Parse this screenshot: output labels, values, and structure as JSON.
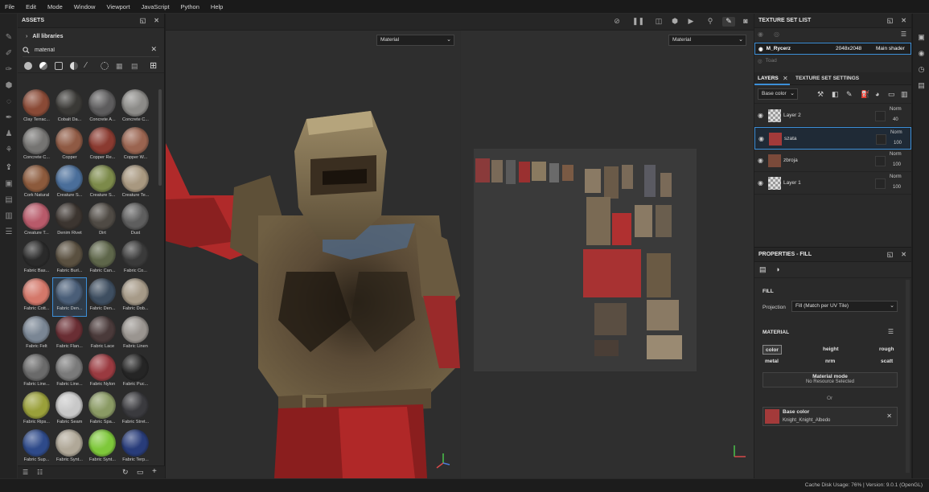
{
  "menu": [
    "File",
    "Edit",
    "Mode",
    "Window",
    "Viewport",
    "JavaScript",
    "Python",
    "Help"
  ],
  "assets": {
    "title": "ASSETS",
    "breadcrumb": "All libraries",
    "search_value": "material",
    "materials": [
      {
        "label": "Clay Terrac...",
        "color": "#8a4a36"
      },
      {
        "label": "Cobalt Da...",
        "color": "#3a3936"
      },
      {
        "label": "Concrete A...",
        "color": "#5d5c5d"
      },
      {
        "label": "Concrete C...",
        "color": "#8c8b88"
      },
      {
        "label": "Concrete C...",
        "color": "#757472"
      },
      {
        "label": "Copper",
        "color": "#8f5a44"
      },
      {
        "label": "Copper Re...",
        "color": "#8a3a30"
      },
      {
        "label": "Copper W...",
        "color": "#9a6450"
      },
      {
        "label": "Cork Natural",
        "color": "#8c5a3c"
      },
      {
        "label": "Creature S...",
        "color": "#4a6e9a"
      },
      {
        "label": "Creature S...",
        "color": "#7c8a4a"
      },
      {
        "label": "Creature Te...",
        "color": "#a89880"
      },
      {
        "label": "Creature T...",
        "color": "#b85a6a"
      },
      {
        "label": "Denim Rivet",
        "color": "#3c3530"
      },
      {
        "label": "Dirt",
        "color": "#4f4a44"
      },
      {
        "label": "Dust",
        "color": "#5e5e5e"
      },
      {
        "label": "Fabric Bas...",
        "color": "#2a2a2a"
      },
      {
        "label": "Fabric Burl...",
        "color": "#5a5040"
      },
      {
        "label": "Fabric Can...",
        "color": "#5e664a"
      },
      {
        "label": "Fabric Co...",
        "color": "#3a3a3a"
      },
      {
        "label": "Fabric Cott...",
        "color": "#d4786a"
      },
      {
        "label": "Fabric Den...",
        "color": "#4a5e78"
      },
      {
        "label": "Fabric Den...",
        "color": "#3e4e60"
      },
      {
        "label": "Fabric Dob...",
        "color": "#a69a88"
      },
      {
        "label": "Fabric Felt",
        "color": "#7a8694"
      },
      {
        "label": "Fabric Flan...",
        "color": "#6a2e34"
      },
      {
        "label": "Fabric Lace",
        "color": "#4a3a3a"
      },
      {
        "label": "Fabric Linen",
        "color": "#9a9590"
      },
      {
        "label": "Fabric Line...",
        "color": "#6a6a6a"
      },
      {
        "label": "Fabric Line...",
        "color": "#7a7a7a"
      },
      {
        "label": "Fabric Nylon",
        "color": "#9a3a40"
      },
      {
        "label": "Fabric Puc...",
        "color": "#252525"
      },
      {
        "label": "Fabric Rips...",
        "color": "#9aa03a"
      },
      {
        "label": "Fabric Seam",
        "color": "#c8c8c8"
      },
      {
        "label": "Fabric Spa...",
        "color": "#8a9a64"
      },
      {
        "label": "Fabric Stret...",
        "color": "#3a3a3e"
      },
      {
        "label": "Fabric Sup...",
        "color": "#2e4a8a"
      },
      {
        "label": "Fabric Synt...",
        "color": "#b0a898"
      },
      {
        "label": "Fabric Synt...",
        "color": "#7ec83a"
      },
      {
        "label": "Fabric Terp...",
        "color": "#283c7a"
      },
      {
        "label": "",
        "color": "#cfcfcf"
      },
      {
        "label": "",
        "color": "#8a8a8a"
      },
      {
        "label": "",
        "color": "#9a9a9a"
      },
      {
        "label": "",
        "color": "#6e6e6e"
      }
    ]
  },
  "viewport": {
    "left_dropdown": "Material",
    "right_dropdown": "Material"
  },
  "texture_set_list": {
    "title": "TEXTURE SET LIST",
    "item_name": "M_Rycerz",
    "item_size": "2048x2048",
    "item_shader": "Main shader",
    "sub_item": "Toad"
  },
  "layers": {
    "tab_layers": "LAYERS",
    "tab_settings": "TEXTURE SET SETTINGS",
    "channel": "Base color",
    "items": [
      {
        "name": "Layer 2",
        "blend": "Norm",
        "opacity": "40",
        "thumb": "#bdbdbd"
      },
      {
        "name": "szata",
        "blend": "Norm",
        "opacity": "100",
        "thumb": "#a33a3a"
      },
      {
        "name": "zbroja",
        "blend": "Norm",
        "opacity": "100",
        "thumb": "#7a4a3a"
      },
      {
        "name": "Layer 1",
        "blend": "Norm",
        "opacity": "100",
        "thumb": "#bdbdbd"
      }
    ]
  },
  "properties": {
    "title": "PROPERTIES - FILL",
    "fill_header": "FILL",
    "projection_label": "Projection",
    "projection_value": "Fill (Match per UV Tile)",
    "material_header": "MATERIAL",
    "channels": [
      "color",
      "height",
      "rough",
      "metal",
      "nrm",
      "scatt"
    ],
    "material_mode_title": "Material mode",
    "material_mode_sub": "No Resource Selected",
    "or_label": "Or",
    "base_color_title": "Base color",
    "base_color_resource": "Knight_Knight_Albedo"
  },
  "status": {
    "text": "Cache Disk Usage:   76% | Version: 9.0.1 (OpenGL)"
  },
  "colors": {
    "accent": "#3c8fd8",
    "panel": "#2b2b2b",
    "armor": "#6f5f43",
    "cloth_red": "#b02a2a"
  }
}
